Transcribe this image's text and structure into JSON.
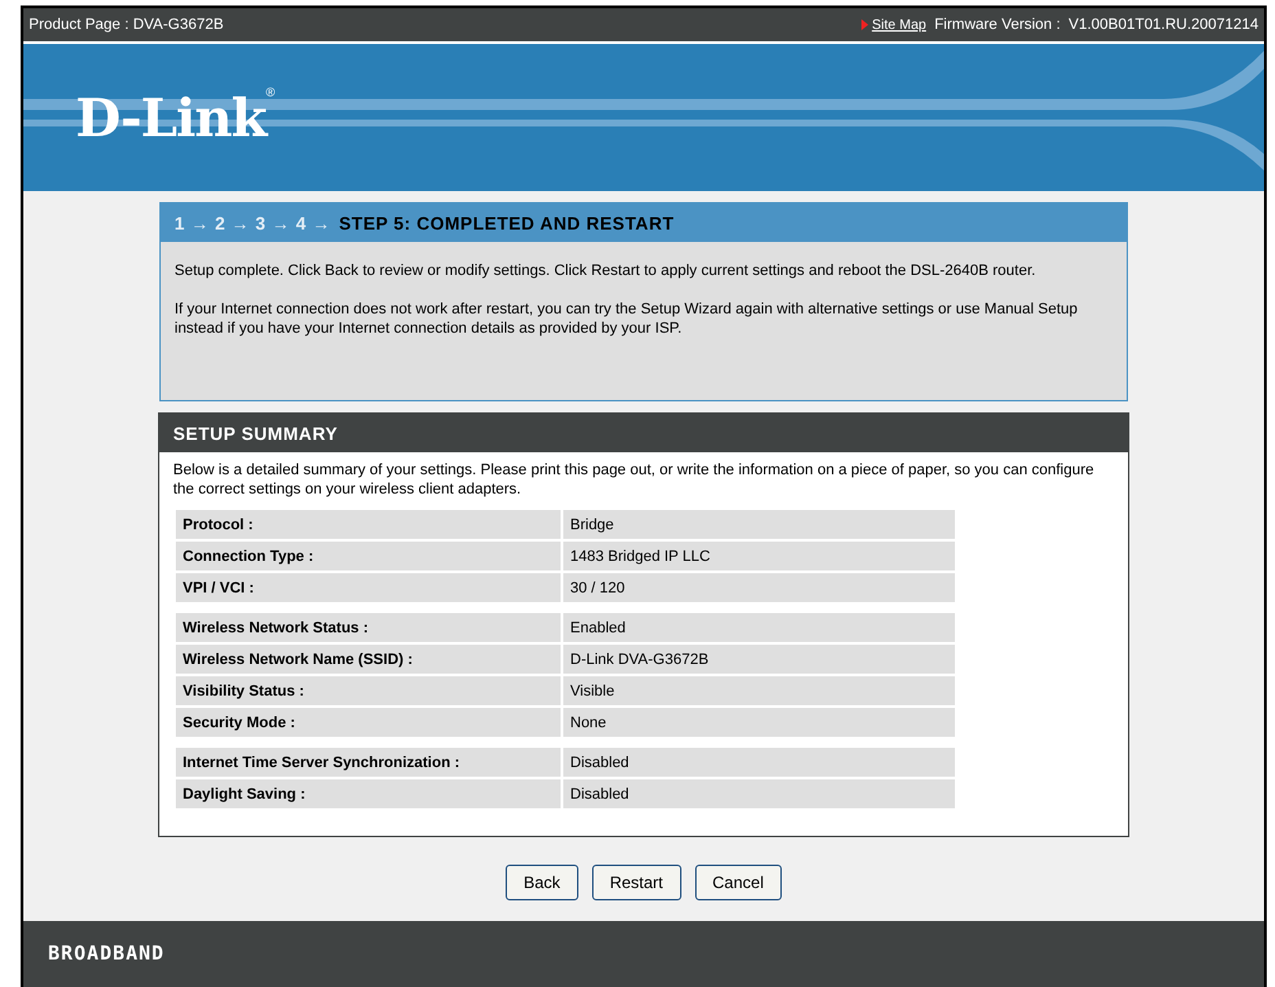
{
  "top_bar": {
    "product": "Product Page : DVA-G3672B",
    "site_map": "Site Map",
    "firmware_label": "Firmware Version :",
    "firmware": "V1.00B01T01.RU.20071214"
  },
  "banner": {
    "logo": "D-Link",
    "logo_mark": "®"
  },
  "step_box": {
    "trail": "1 → 2 → 3 → 4 →",
    "title": "STEP 5: COMPLETED AND RESTART",
    "paragraphs": [
      "Setup complete. Click Back to review or modify settings. Click Restart to apply current settings and reboot the DSL-2640B router.",
      "If your Internet connection does not work after restart, you can try the Setup Wizard again with alternative settings or use Manual Setup instead if you have your Internet connection details as provided by your ISP."
    ]
  },
  "summary": {
    "title": "SETUP SUMMARY",
    "intro": "Below is a detailed summary of your settings. Please print this page out, or write the information on a piece of paper, so you can configure the correct settings on your wireless client adapters.",
    "groups": [
      [
        {
          "label": "Protocol :",
          "value": "Bridge"
        },
        {
          "label": "Connection Type  :",
          "value": "1483 Bridged IP LLC"
        },
        {
          "label": "VPI / VCI  :",
          "value": "30 / 120"
        }
      ],
      [
        {
          "label": "Wireless Network Status :",
          "value": "Enabled"
        },
        {
          "label": "Wireless Network Name (SSID) :",
          "value": "D-Link DVA-G3672B"
        },
        {
          "label": "Visibility Status :",
          "value": "Visible"
        },
        {
          "label": "Security Mode :",
          "value": "None"
        }
      ],
      [
        {
          "label": "Internet Time Server Synchronization :",
          "value": "Disabled"
        },
        {
          "label": "Daylight Saving :",
          "value": "Disabled"
        }
      ]
    ]
  },
  "buttons": [
    "Back",
    "Restart",
    "Cancel"
  ],
  "footer": {
    "text": "BROADBAND"
  }
}
